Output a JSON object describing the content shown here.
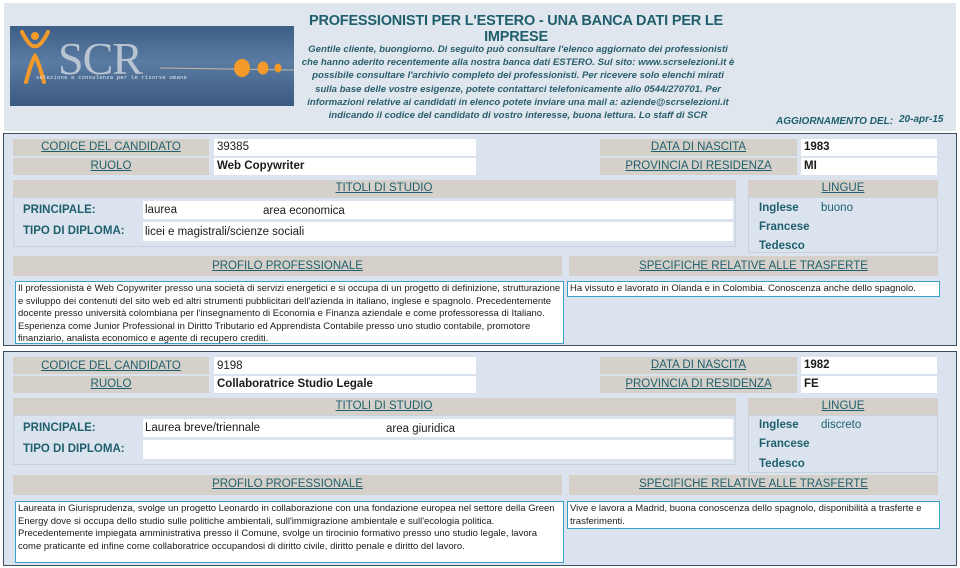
{
  "header": {
    "logo": {
      "brand": "SCR",
      "tagline": "selezione e consulenza per le risorse umane",
      "icon": "person-figure-icon"
    },
    "title": "PROFESSIONISTI PER L'ESTERO - UNA BANCA DATI PER LE IMPRESE",
    "intro": "Gentile cliente, buongiorno. Di seguito può consultare l'elenco aggiornato dei professionisti che hanno aderito recentemente alla nostra banca dati ESTERO. Sul sito: www.scrselezioni.it è possibile consultare l'archivio completo dei professionisti. Per ricevere solo elenchi mirati sulla base delle vostre esigenze, potete contattarci telefonicamente allo 0544/270701. Per informazioni relative ai candidati in elenco potete inviare una mail a: aziende@scrselezioni.it indicando il codice del candidato di vostro interesse, buona lettura. Lo staff di SCR",
    "update_label": "AGGIORNAMENTO DEL:",
    "update_value": "20-apr-15"
  },
  "labels": {
    "code": "CODICE DEL CANDIDATO",
    "role": "RUOLO",
    "birth": "DATA DI NASCITA",
    "province": "PROVINCIA DI RESIDENZA",
    "education": "TITOLI DI STUDIO",
    "languages": "LINGUE",
    "main": "PRINCIPALE:",
    "diploma": "TIPO DI DIPLOMA:",
    "profile": "PROFILO PROFESSIONALE",
    "travel": "SPECIFICHE RELATIVE ALLE TRASFERTE"
  },
  "candidates": [
    {
      "code": "39385",
      "role": "Web Copywriter",
      "birth_year": "1983",
      "province": "MI",
      "education_main": "laurea",
      "education_area": "area economica",
      "diploma": "licei e magistrali/scienze sociali",
      "languages": [
        {
          "name": "Inglese",
          "level": "buono"
        },
        {
          "name": "Francese",
          "level": ""
        },
        {
          "name": "Tedesco",
          "level": ""
        }
      ],
      "profile": "Il professionista è Web Copywriter presso una società di servizi energetici e si occupa di un progetto di definizione, strutturazione e sviluppo dei contenuti del sito web ed altri strumenti pubblicitari dell'azienda in italiano, inglese e spagnolo. Precedentemente docente presso università colombiana per l'insegnamento di Economia e Finanza aziendale e come professoressa di Italiano. Esperienza come Junior Professional in Diritto Tributario ed Apprendista Contabile presso uno studio contabile, promotore finanziario, analista economico e agente di recupero crediti.",
      "travel": "Ha vissuto e lavorato in Olanda e in Colombia. Conoscenza anche dello spagnolo."
    },
    {
      "code": "9198",
      "role": "Collaboratrice Studio Legale",
      "birth_year": "1982",
      "province": "FE",
      "education_main": "Laurea breve/triennale",
      "education_area": "area giuridica",
      "diploma": "",
      "languages": [
        {
          "name": "Inglese",
          "level": "discreto"
        },
        {
          "name": "Francese",
          "level": ""
        },
        {
          "name": "Tedesco",
          "level": ""
        }
      ],
      "profile": "Laureata in Giurisprudenza, svolge un progetto Leonardo in collaborazione con una fondazione europea nel settore della Green Energy dove si occupa dello studio sulle politiche ambientali, sull'immigrazione ambientale e sull'ecologia politica. Precedentemente impiegata amministrativa presso il Comune, svolge un tirocinio formativo presso uno studio legale, lavora come praticante ed infine come collaboratrice occupandosi di diritto civile, diritto penale e diritto del lavoro.",
      "travel": "Vive e lavora a Madrid, buona conoscenza dello spagnolo, disponibilità a trasferte e trasferimenti."
    }
  ],
  "colors": {
    "accent_text": "#1f5f6d",
    "label_bg": "#d5d1ca",
    "card_bg": "#dbe4ee",
    "textbox_border": "#3ba0c8",
    "logo_orange": "#f39a2b"
  }
}
